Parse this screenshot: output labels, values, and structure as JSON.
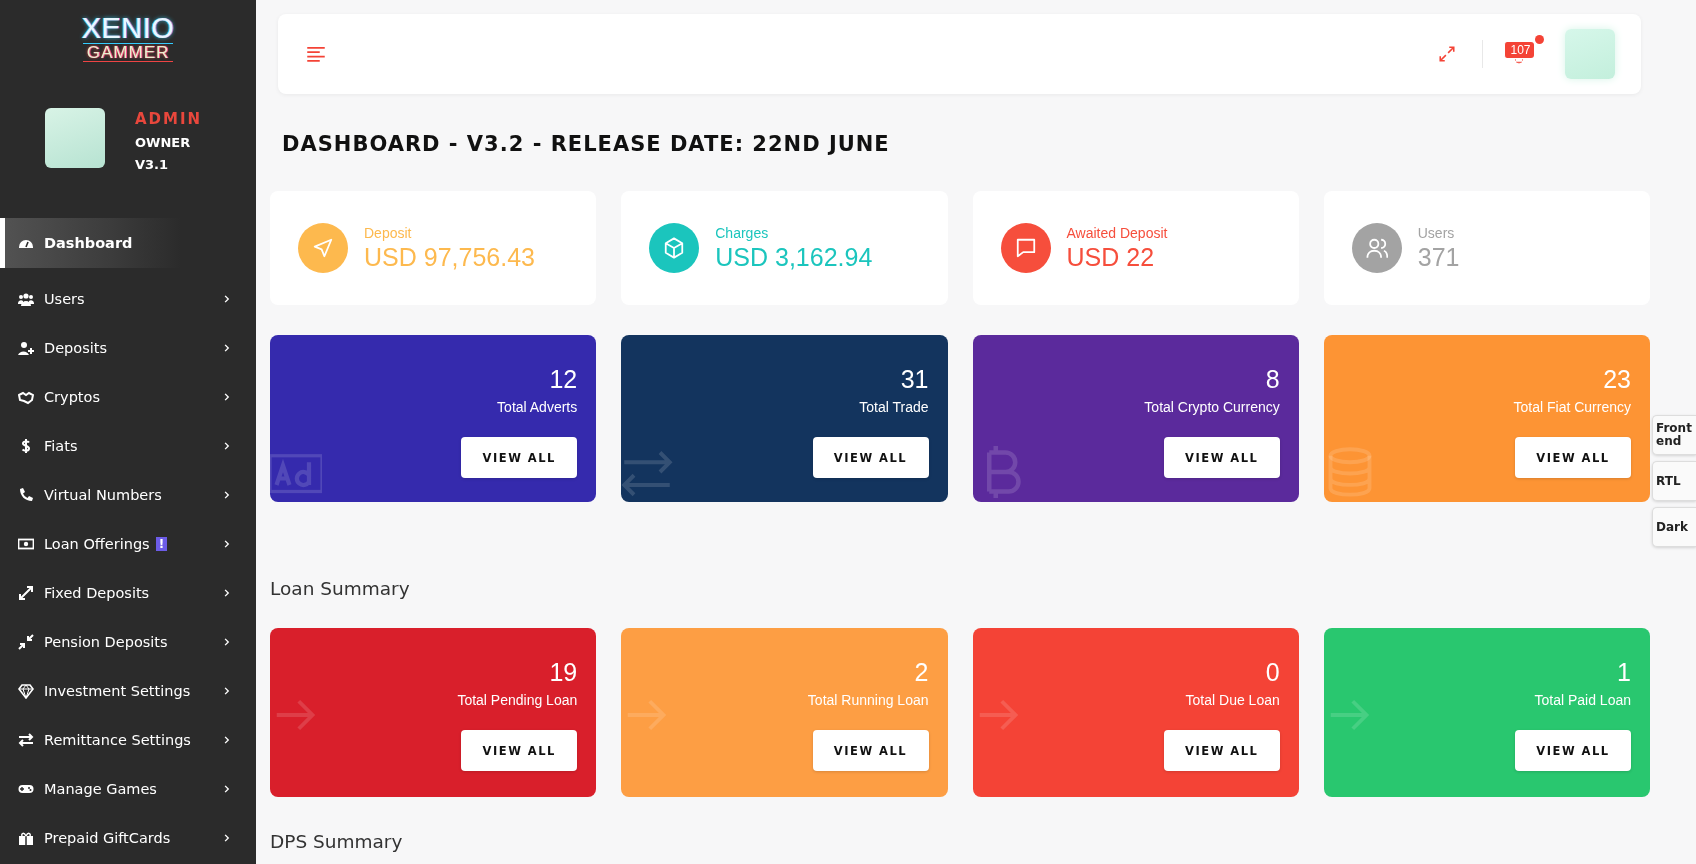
{
  "sidebar": {
    "logo": {
      "line_1": "XENIO",
      "line_2": "GAMMER"
    },
    "profile": {
      "role": "ADMIN",
      "title": "OWNER",
      "version": "V3.1"
    },
    "items": [
      {
        "label": "Dashboard",
        "selected": true,
        "expandable": false
      },
      {
        "label": "Users",
        "selected": false,
        "expandable": true
      },
      {
        "label": "Deposits",
        "selected": false,
        "expandable": true
      },
      {
        "label": "Cryptos",
        "selected": false,
        "expandable": true
      },
      {
        "label": "Fiats",
        "selected": false,
        "expandable": true
      },
      {
        "label": "Virtual Numbers",
        "selected": false,
        "expandable": true
      },
      {
        "label": "Loan Offerings",
        "selected": false,
        "expandable": true,
        "badge": "!"
      },
      {
        "label": "Fixed Deposits",
        "selected": false,
        "expandable": true
      },
      {
        "label": "Pension Deposits",
        "selected": false,
        "expandable": true
      },
      {
        "label": "Investment Settings",
        "selected": false,
        "expandable": true
      },
      {
        "label": "Remittance Settings",
        "selected": false,
        "expandable": true
      },
      {
        "label": "Manage Games",
        "selected": false,
        "expandable": true
      },
      {
        "label": "Prepaid GiftCards",
        "selected": false,
        "expandable": true
      }
    ]
  },
  "topbar": {
    "notification_count": "107"
  },
  "title": "DASHBOARD - V3.2 - RELEASE DATE: 22ND JUNE",
  "stats": [
    {
      "label": "Deposit",
      "value": "USD 97,756.43",
      "color": "#fdb94e"
    },
    {
      "label": "Charges",
      "value": "USD 3,162.94",
      "color": "#1bc5bd"
    },
    {
      "label": "Awaited Deposit",
      "value": "USD 22",
      "color": "#f64e3c"
    },
    {
      "label": "Users",
      "value": "371",
      "color": "#a3a3a3"
    }
  ],
  "totals": [
    {
      "value": "12",
      "label": "Total Adverts",
      "button": "VIEW ALL",
      "color": "#352aad"
    },
    {
      "value": "31",
      "label": "Total Trade",
      "button": "VIEW ALL",
      "color": "#13345e"
    },
    {
      "value": "8",
      "label": "Total Crypto Currency",
      "button": "VIEW ALL",
      "color": "#5b2a9c"
    },
    {
      "value": "23",
      "label": "Total Fiat Currency",
      "button": "VIEW ALL",
      "color": "#fd9434"
    }
  ],
  "loan_summary": {
    "heading": "Loan Summary",
    "cards": [
      {
        "value": "19",
        "label": "Total Pending Loan",
        "button": "VIEW ALL",
        "color": "#d91f2b"
      },
      {
        "value": "2",
        "label": "Total Running Loan",
        "button": "VIEW ALL",
        "color": "#fd9e44"
      },
      {
        "value": "0",
        "label": "Total Due Loan",
        "button": "VIEW ALL",
        "color": "#f44336"
      },
      {
        "value": "1",
        "label": "Total Paid Loan",
        "button": "VIEW ALL",
        "color": "#29c76f"
      }
    ]
  },
  "dps_summary": {
    "heading": "DPS Summary"
  },
  "side_tabs": [
    "Front end",
    "RTL",
    "Dark"
  ]
}
